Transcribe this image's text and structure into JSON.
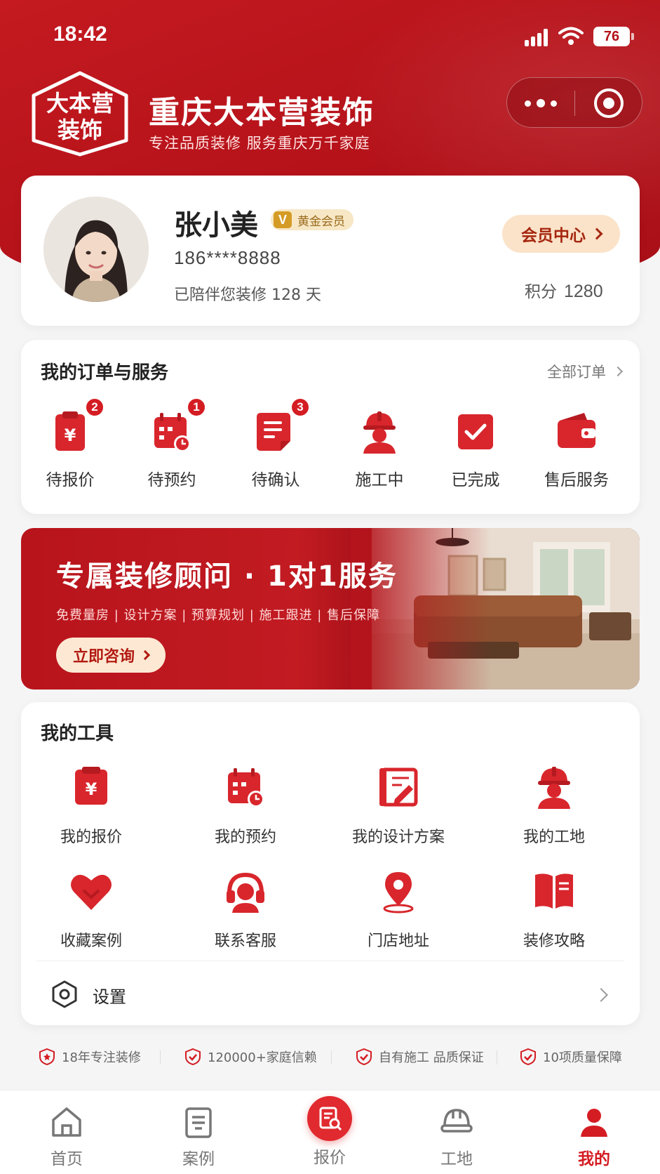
{
  "status_bar": {
    "time": "18:42",
    "battery": "76"
  },
  "brand": {
    "logo_line1": "大本营",
    "logo_line2": "装饰",
    "name": "重庆大本营装饰",
    "slogan": "专注品质装修  服务重庆万千家庭"
  },
  "profile": {
    "name": "张小美",
    "vip_letter": "V",
    "vip_level": "黄金会员",
    "phone": "186****8888",
    "days_text": "已陪伴您装修 128 天",
    "member_center": "会员中心",
    "points_label": "积分",
    "points_value": "1280"
  },
  "orders": {
    "title": "我的订单与服务",
    "all_label": "全部订单",
    "items": [
      {
        "label": "待报价",
        "icon": "quote-icon",
        "badge": "2"
      },
      {
        "label": "待预约",
        "icon": "calendar-icon",
        "badge": "1"
      },
      {
        "label": "待确认",
        "icon": "document-icon",
        "badge": "3"
      },
      {
        "label": "施工中",
        "icon": "worker-icon",
        "badge": ""
      },
      {
        "label": "已完成",
        "icon": "check-icon",
        "badge": ""
      },
      {
        "label": "售后服务",
        "icon": "wallet-icon",
        "badge": ""
      }
    ]
  },
  "banner": {
    "title": "专属装修顾问 · 1对1服务",
    "subtitle": "免费量房 | 设计方案 | 预算规划 | 施工跟进 | 售后保障",
    "button": "立即咨询"
  },
  "tools": {
    "title": "我的工具",
    "items": [
      {
        "label": "我的报价",
        "icon": "quote-icon"
      },
      {
        "label": "我的预约",
        "icon": "calendar-icon"
      },
      {
        "label": "我的设计方案",
        "icon": "blueprint-icon"
      },
      {
        "label": "我的工地",
        "icon": "worker-icon"
      },
      {
        "label": "收藏案例",
        "icon": "heart-icon"
      },
      {
        "label": "联系客服",
        "icon": "headset-icon"
      },
      {
        "label": "门店地址",
        "icon": "location-icon"
      },
      {
        "label": "装修攻略",
        "icon": "book-icon"
      }
    ],
    "settings_label": "设置"
  },
  "trust": [
    "18年专注装修",
    "120000+家庭信赖",
    "自有施工 品质保证",
    "10项质量保障"
  ],
  "tabbar": [
    {
      "label": "首页",
      "icon": "home-icon"
    },
    {
      "label": "案例",
      "icon": "cases-icon"
    },
    {
      "label": "报价",
      "icon": "quote-tab-icon"
    },
    {
      "label": "工地",
      "icon": "helmet-icon"
    },
    {
      "label": "我的",
      "icon": "user-icon"
    }
  ],
  "colors": {
    "brand_red": "#c41a20",
    "accent_red": "#d41d23",
    "gold": "#d59c25"
  }
}
